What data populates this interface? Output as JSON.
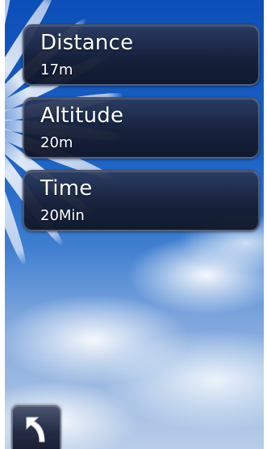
{
  "metrics": [
    {
      "title": "Distance",
      "value": "17m"
    },
    {
      "title": "Altitude",
      "value": "20m"
    },
    {
      "title": "Time",
      "value": "20Min"
    }
  ],
  "navigation": {
    "back_icon": "back-arrow-icon"
  },
  "colors": {
    "card_background": "#1c2744",
    "card_border": "#7a8296",
    "text": "#ffffff",
    "sky_top": "#0d4fb8"
  }
}
